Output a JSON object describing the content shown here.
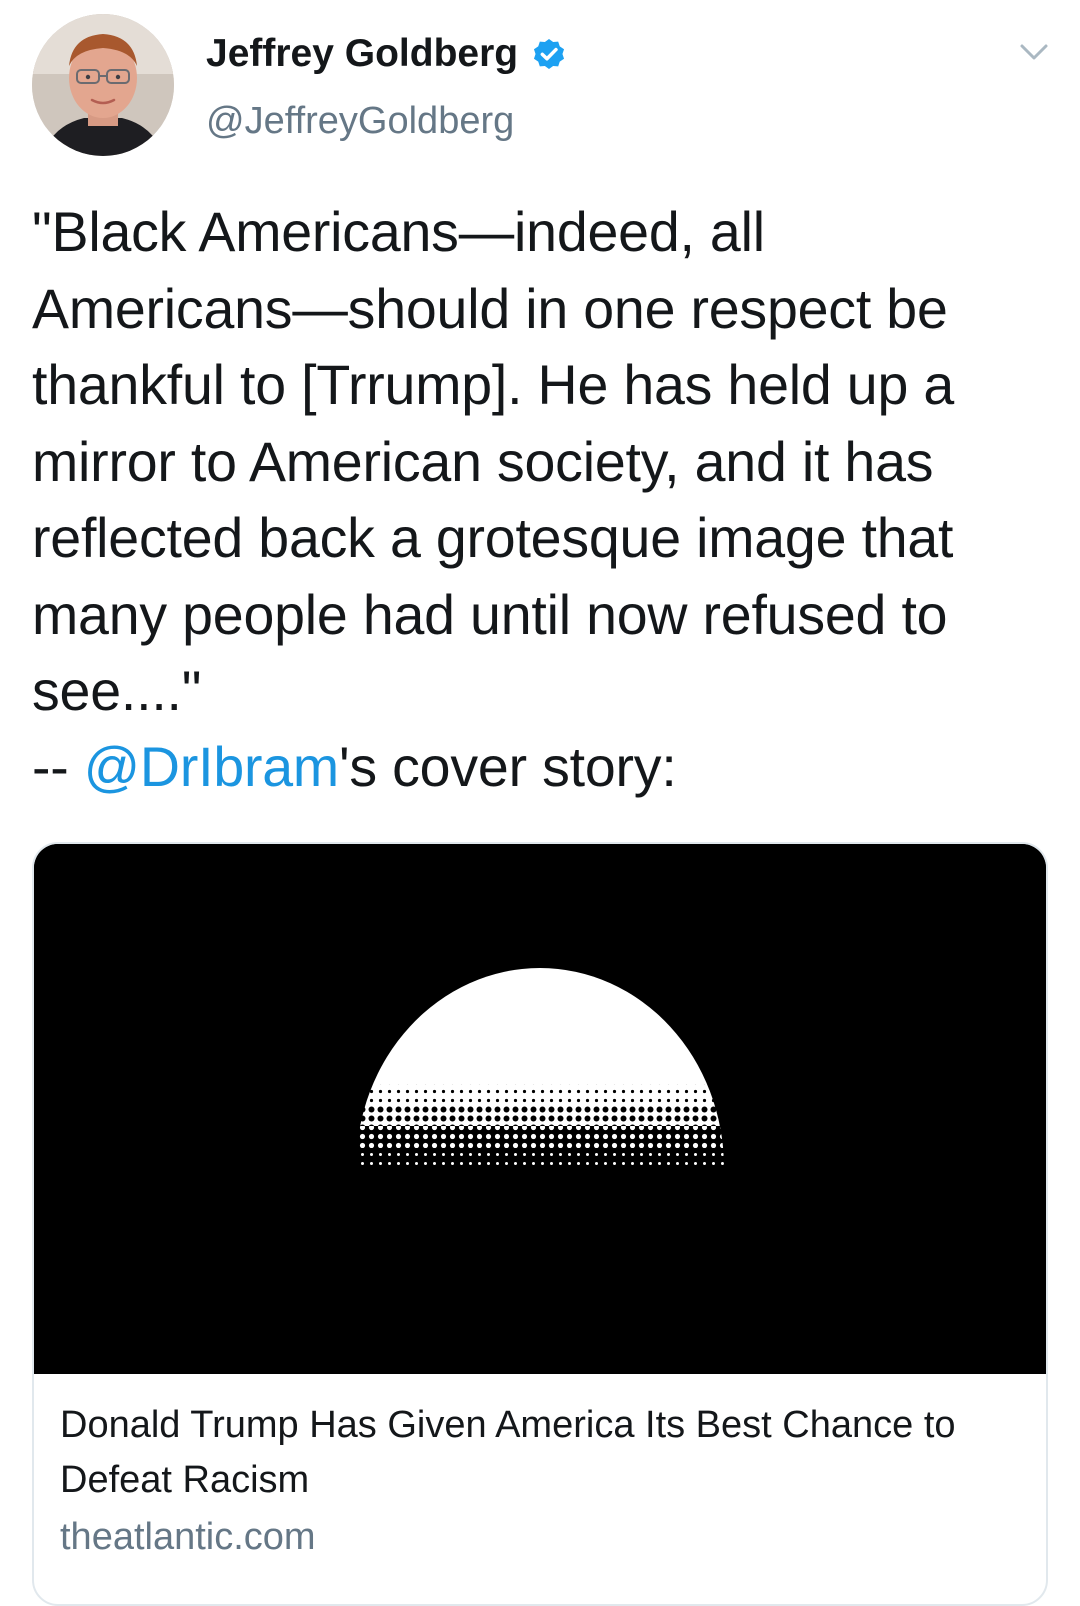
{
  "author": {
    "name": "Jeffrey Goldberg",
    "handle": "@JeffreyGoldberg",
    "verified": true
  },
  "icons": {
    "verified": "verified-badge-icon",
    "menu": "chevron-down-icon"
  },
  "colors": {
    "link": "#1b95e0",
    "verified_badge": "#1da1f2",
    "secondary_text": "#657786"
  },
  "tweet": {
    "text": "\"Black Americans—indeed, all\nAmericans—should in one respect be\nthankful to [Trrump]. He has held up a\nmirror to American society, and it has\nreflected back a grotesque image that\nmany people had until now refused to\nsee....\"",
    "attribution_prefix": "-- ",
    "mention": "@DrIbram",
    "attribution_suffix": "'s cover story:"
  },
  "card": {
    "title": "Donald Trump Has Given America Its Best Chance to Defeat Racism",
    "domain": "theatlantic.com"
  }
}
